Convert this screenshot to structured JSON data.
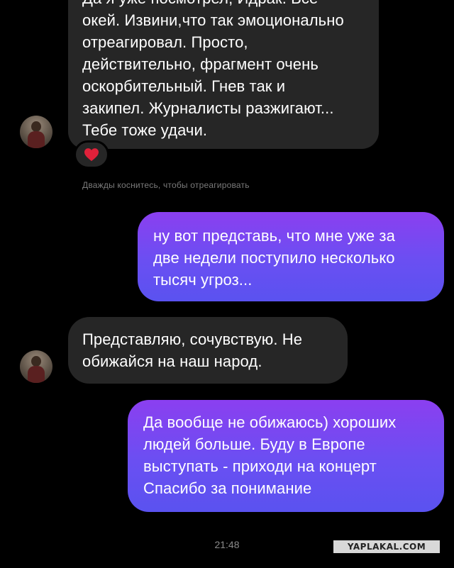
{
  "messages": [
    {
      "direction": "incoming",
      "lines": [
        "Да я уже посмотрел, Идрак. Всё",
        "окей. Извини,что так эмоционально",
        "отреагировал. Просто,",
        "действительно, фрагмент очень",
        "оскорбительный. Гнев так и",
        "закипел. Журналисты разжигают...",
        "Тебе тоже удачи."
      ],
      "reaction": "red-heart"
    },
    {
      "direction": "outgoing",
      "lines": [
        "ну вот представь, что мне уже за",
        "две недели поступило несколько",
        "тысяч угроз..."
      ]
    },
    {
      "direction": "incoming",
      "lines": [
        "Представляю, сочувствую. Не",
        "обижайся на наш народ."
      ]
    },
    {
      "direction": "outgoing",
      "lines": [
        "Да вообще не обижаюсь) хороших",
        "людей больше. Буду в Европе",
        "выступать - приходи на концерт",
        "Спасибо за понимание"
      ]
    }
  ],
  "reaction_hint": "Дважды коснитесь, чтобы отреагировать",
  "timestamp": "21:48",
  "watermark": "YAPLAKAL.COM",
  "colors": {
    "background": "#000000",
    "incoming_bubble": "#262626",
    "outgoing_gradient_top": "#8b3ff0",
    "outgoing_gradient_bottom": "#5a52f0",
    "reaction_heart": "#e0213a"
  }
}
